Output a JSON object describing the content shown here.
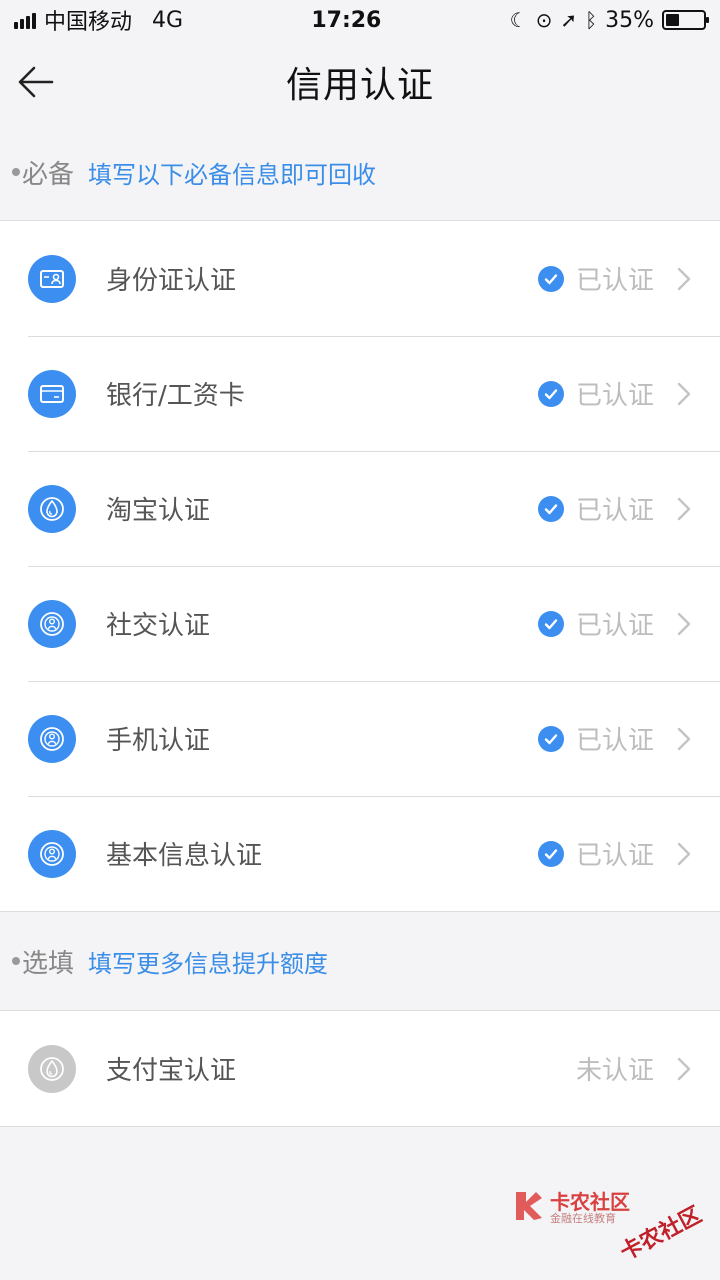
{
  "status_bar": {
    "carrier": "中国移动",
    "network": "4G",
    "time": "17:26",
    "battery_percent": "35%",
    "battery_level": 0.35,
    "icons": [
      "moon-icon",
      "rotation-lock-icon",
      "location-icon",
      "bluetooth-icon"
    ]
  },
  "nav": {
    "back_icon": "arrow-left-icon",
    "title": "信用认证"
  },
  "required_section": {
    "label": "必备",
    "hint": "填写以下必备信息即可回收",
    "items": [
      {
        "icon": "id-card-icon",
        "label": "身份证认证",
        "status": "已认证"
      },
      {
        "icon": "bank-card-icon",
        "label": "银行/工资卡",
        "status": "已认证"
      },
      {
        "icon": "droplet-icon",
        "label": "淘宝认证",
        "status": "已认证"
      },
      {
        "icon": "person-badge-icon",
        "label": "社交认证",
        "status": "已认证"
      },
      {
        "icon": "person-badge-icon",
        "label": "手机认证",
        "status": "已认证"
      },
      {
        "icon": "person-badge-icon",
        "label": "基本信息认证",
        "status": "已认证"
      }
    ]
  },
  "optional_section": {
    "label": "选填",
    "hint": "填写更多信息提升额度",
    "items": [
      {
        "icon": "droplet-icon",
        "label": "支付宝认证",
        "status": "未认证"
      }
    ]
  },
  "watermark": {
    "brand": "卡农社区",
    "tagline": "金融在线教育"
  },
  "colors": {
    "accent": "#3c8ff0",
    "hint_text": "#3b8ee8",
    "inactive": "#c8c8c8",
    "background": "#f4f4f6"
  }
}
